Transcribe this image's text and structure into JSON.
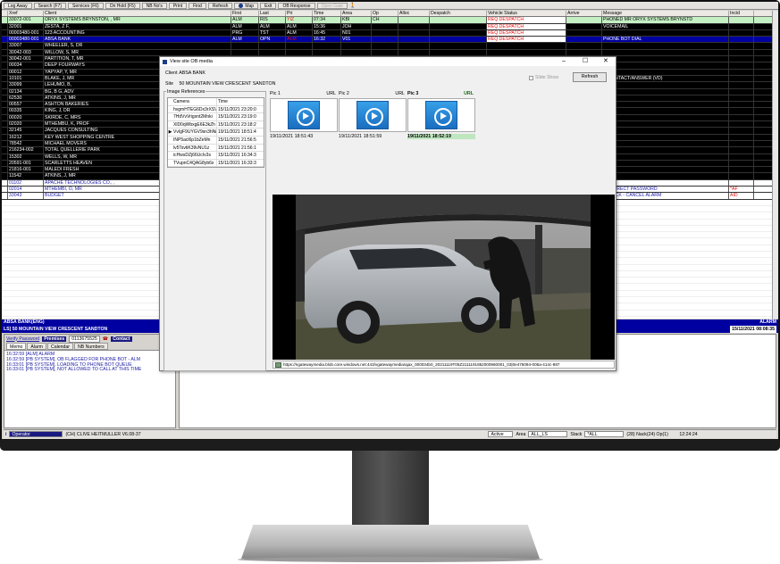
{
  "toolbar": {
    "buttons": [
      "Log Away",
      "Search (F7)",
      "Services (F6)",
      "On Hold (F5)",
      "NB No's",
      "Print",
      "Find",
      "Refresh",
      "Map",
      "Exit",
      "OB Response",
      "Open Gate"
    ]
  },
  "grid": {
    "headers": [
      "",
      "Xref",
      "Client",
      "First",
      "Last",
      "Pri",
      "Time",
      "Area",
      "Op",
      "Alloc",
      "Despatch",
      "Vehicle Status",
      "Arrive",
      "Message",
      "Incid"
    ],
    "rows": [
      {
        "style": "green",
        "cells": [
          "",
          "33072-001",
          "ORYX SYSTEMS BRYNSTON, , MR",
          "ALM",
          "RIS",
          "YIZ",
          "07:34",
          "KBI",
          "CH",
          "",
          "",
          "REQ DESPATCH",
          "",
          "PHONED MR ORYX SYSTEMS BRYNSTD",
          ""
        ]
      },
      {
        "style": "black",
        "cells": [
          "",
          "32001",
          "ZESTA, Z F,",
          "ALM",
          "ALM",
          "ALM",
          "15:36",
          "JOH",
          "",
          "",
          "",
          "REQ DESPATCH",
          "",
          "VOICEMAIL",
          ""
        ]
      },
      {
        "style": "black",
        "cells": [
          "",
          "00003480-001",
          "123 ACCOUNTING",
          "PRG",
          "TST",
          "ALM",
          "16:45",
          "N01",
          "",
          "",
          "",
          "REQ DESPATCH",
          "",
          "",
          ""
        ]
      },
      {
        "style": "blue",
        "cells": [
          "",
          "00003480-001",
          "ABSA BANK",
          "ALM",
          "OPN",
          "ALM",
          "16:32",
          "V01",
          "",
          "",
          "",
          "REQ DESPATCH",
          "",
          "PHONE BOT DIAL",
          ""
        ]
      },
      {
        "style": "black",
        "cells": [
          "",
          "33007",
          "WHEELER, S, DR",
          "",
          "",
          "",
          "",
          "",
          "",
          "",
          "",
          "",
          "",
          "",
          ""
        ]
      },
      {
        "style": "black",
        "cells": [
          "",
          "30042-003",
          "WILLOW, S, MR",
          "",
          "",
          "",
          "",
          "",
          "",
          "",
          "",
          "",
          "",
          "",
          ""
        ]
      },
      {
        "style": "black",
        "cells": [
          "",
          "30042-001",
          "PARTITION, T, MR",
          "",
          "",
          "",
          "",
          "",
          "",
          "",
          "",
          "",
          "",
          "",
          ""
        ]
      },
      {
        "style": "black",
        "cells": [
          "",
          "00034",
          "DEEP FOURWAYS",
          "",
          "",
          "",
          "",
          "",
          "",
          "",
          "",
          "",
          "",
          "",
          ""
        ]
      },
      {
        "style": "black",
        "cells": [
          "",
          "00012",
          "YAPYAP, Y, MR",
          "",
          "",
          "",
          "",
          "",
          "",
          "",
          "",
          "",
          "",
          "",
          ""
        ]
      },
      {
        "style": "black",
        "cells": [
          "",
          "10101",
          "BLAKE, J, MR",
          "",
          "",
          "",
          "",
          "",
          "",
          "",
          "",
          "",
          "",
          "O CONTACT/ANSWER (VD)",
          ""
        ]
      },
      {
        "style": "black",
        "cells": [
          "",
          "33099",
          "LEHUMO, B,",
          "",
          "",
          "",
          "",
          "",
          "",
          "",
          "",
          "",
          "",
          "",
          ""
        ]
      },
      {
        "style": "black",
        "cells": [
          "",
          "02134",
          "BG, B G, ADV",
          "",
          "",
          "",
          "",
          "",
          "",
          "",
          "",
          "",
          "",
          "",
          ""
        ]
      },
      {
        "style": "black",
        "cells": [
          "",
          "62530",
          "ATKINS, J, MR",
          "",
          "",
          "",
          "",
          "",
          "",
          "",
          "",
          "",
          "",
          "",
          ""
        ]
      },
      {
        "style": "black",
        "cells": [
          "",
          "00557",
          "ASHTON BAKERIES",
          "",
          "",
          "",
          "",
          "",
          "",
          "",
          "",
          "",
          "",
          "",
          ""
        ]
      },
      {
        "style": "black",
        "cells": [
          "",
          "00335",
          "KING, J, DR",
          "",
          "",
          "",
          "",
          "",
          "",
          "",
          "",
          "",
          "",
          "",
          ""
        ]
      },
      {
        "style": "black",
        "cells": [
          "",
          "00020",
          "SKIRDE, C, MRS",
          "",
          "",
          "",
          "",
          "",
          "",
          "",
          "",
          "",
          "",
          "",
          ""
        ]
      },
      {
        "style": "black",
        "cells": [
          "",
          "02020",
          "MTHEMBU, K, PROF",
          "",
          "",
          "",
          "",
          "",
          "",
          "",
          "",
          "",
          "",
          "",
          ""
        ]
      },
      {
        "style": "black",
        "cells": [
          "",
          "32145",
          "JACQUES CONSULTING",
          "",
          "",
          "",
          "",
          "",
          "",
          "",
          "",
          "",
          "",
          "",
          ""
        ]
      },
      {
        "style": "black",
        "cells": [
          "",
          "16212",
          "KEY WEST SHOPPING CENTRE",
          "",
          "",
          "",
          "",
          "",
          "",
          "",
          "",
          "",
          "",
          "",
          ""
        ]
      },
      {
        "style": "black",
        "cells": [
          "",
          "78542",
          "MICHAEL MOVERS",
          "",
          "",
          "",
          "",
          "",
          "",
          "",
          "",
          "",
          "",
          "",
          ""
        ]
      },
      {
        "style": "black",
        "cells": [
          "",
          "216234-002",
          "TOTAL QUELLERIE PARK",
          "",
          "",
          "",
          "",
          "",
          "",
          "",
          "",
          "",
          "",
          "",
          ""
        ]
      },
      {
        "style": "black",
        "cells": [
          "",
          "15302",
          "WELLS, W, MR",
          "",
          "",
          "",
          "",
          "",
          "",
          "",
          "",
          "",
          "",
          "",
          ""
        ]
      },
      {
        "style": "black",
        "cells": [
          "",
          "20591-001",
          "SCARLETTS HEAVEN",
          "",
          "",
          "",
          "",
          "",
          "",
          "",
          "",
          "",
          "",
          "",
          ""
        ]
      },
      {
        "style": "black",
        "cells": [
          "",
          "21816-001",
          "MALEDI FRESH",
          "",
          "",
          "",
          "",
          "",
          "",
          "",
          "",
          "",
          "",
          "",
          ""
        ]
      },
      {
        "style": "black",
        "cells": [
          "",
          "11542",
          "ATKINS, J, MR",
          "",
          "",
          "",
          "",
          "",
          "",
          "",
          "",
          "",
          "",
          "",
          ""
        ]
      },
      {
        "style": "white",
        "cells": [
          "",
          "01102",
          "APACHE TECHNOLOGIES CO., ,",
          "",
          "",
          "",
          "",
          "",
          "",
          "",
          "",
          "",
          "",
          "",
          ""
        ]
      },
      {
        "style": "white",
        "cells": [
          "",
          "02014",
          "MTHEMBI, O, MR",
          "",
          "",
          "",
          "",
          "",
          "",
          "",
          "",
          "",
          "",
          "NCORRECT PASSWORD",
          "*AF"
        ]
      },
      {
        "style": "white",
        "cells": [
          "",
          "33043",
          "BUDGET",
          "",
          "",
          "",
          "",
          "",
          "",
          "",
          "",
          "",
          "",
          "ALL ACK - CANCEL ALARM",
          "AID"
        ]
      }
    ]
  },
  "bottom": {
    "client_line": "ABSA BANK(ENG)",
    "alarm_label": "ALARM",
    "site_line": "LS] 50 MOUNTAIN VIEW CRESCENT SANDTON",
    "datetime": "15/11/2021  08:08:35",
    "verify_password": "Verify Password",
    "premises_label": "Premises",
    "premises_value": "0113675525",
    "contact_label": "Contact",
    "tabs": [
      "Memo",
      "Alarm",
      "Calendar",
      "NB Numbers"
    ],
    "log": [
      "16:32:59 [ALM] ALARM",
      "16:32:59 [PB SYSTEM], OB FLAGGED FOR PHONE BOT - ALM",
      "16:33:01 [PB SYSTEM], LOADING TO PHONE BOT QUEUE",
      "16:33:01 [PB SYSTEM], NOT ALLOWED TO CALL AT THIS TIME"
    ]
  },
  "statusbar": {
    "operator": "Operator",
    "user": "(CH) CLIVE HEITMULLER V6.08-37",
    "active": "Active",
    "area_label": "Area",
    "area_value": "ALL_LS",
    "stack_label": "Stack",
    "stack_value": "*ALL",
    "counts": "(28) Nack(24) Op(1)",
    "clock": "12:24:24"
  },
  "dialog": {
    "title": "View site OB media",
    "client_label": "Client",
    "client_value": "ABSA BANK",
    "site_label": "Site",
    "site_value": "50 MOUNTAIN VIEW CRESCENT SANDTON",
    "slideshow_label": "Slide Show",
    "refresh_label": "Refresh",
    "image_refs_label": "Image References",
    "ref_headers": [
      "Camera",
      "Time"
    ],
    "refs": [
      {
        "camera": "hvgmHTEG6Dx3rXSV",
        "time": "15/11/2021 23:20:0"
      },
      {
        "camera": "7HdVvVrigxnt2Mnki",
        "time": "15/11/2021 23:19:0"
      },
      {
        "camera": "XlD0qWbxgE6E3kZh",
        "time": "15/11/2021 23:18:2"
      },
      {
        "camera": "VvIgF9UYGV9sn3hNr",
        "time": "19/11/2021 18:51:4"
      },
      {
        "camera": "INP5acl6p1bZeMn",
        "time": "15/11/2021 21:56:5"
      },
      {
        "camera": "lv5TsvtiK39vNU1z",
        "time": "15/11/2021 21:56:1"
      },
      {
        "camera": "icHwsDZj66UcIv3s",
        "time": "15/11/2021 16:34:3"
      },
      {
        "camera": "TVupnC4QAG8yb6x",
        "time": "15/11/2021 16:33:3"
      }
    ],
    "pics": [
      {
        "label": "Pic 1",
        "url": "URL",
        "time": "19/11/2021 18:51:43"
      },
      {
        "label": "Pic 2",
        "url": "URL",
        "time": "19/11/2021 18:51:59"
      },
      {
        "label": "Pic 3",
        "url": "URL",
        "time": "19/11/2021 18:52:19"
      }
    ],
    "image_url": "https://ngatewaymedia.blob.core.windows.net:443/vgatewaymedia/ajax_000034b0_20211119T05Z2111191852000960001_03|0e475094-006a-414c-887"
  }
}
